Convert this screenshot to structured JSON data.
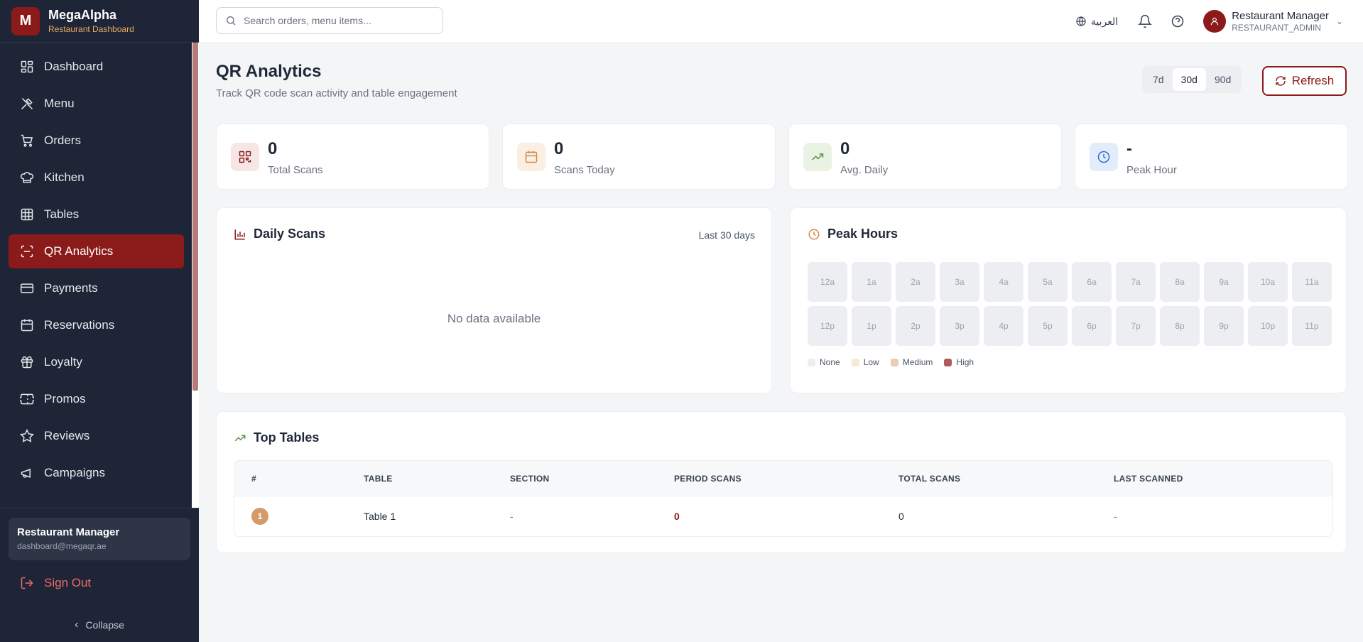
{
  "brand": {
    "logo_letter": "M",
    "name": "MegaAlpha",
    "subtitle": "Restaurant Dashboard"
  },
  "sidebar": {
    "items": [
      {
        "label": "Dashboard",
        "icon": "dashboard-icon"
      },
      {
        "label": "Menu",
        "icon": "utensils-icon"
      },
      {
        "label": "Orders",
        "icon": "cart-icon"
      },
      {
        "label": "Kitchen",
        "icon": "chef-hat-icon"
      },
      {
        "label": "Tables",
        "icon": "grid-icon"
      },
      {
        "label": "QR Analytics",
        "icon": "scan-icon",
        "active": true
      },
      {
        "label": "Payments",
        "icon": "credit-card-icon"
      },
      {
        "label": "Reservations",
        "icon": "calendar-icon"
      },
      {
        "label": "Loyalty",
        "icon": "gift-icon"
      },
      {
        "label": "Promos",
        "icon": "ticket-icon"
      },
      {
        "label": "Reviews",
        "icon": "star-icon"
      },
      {
        "label": "Campaigns",
        "icon": "megaphone-icon"
      }
    ],
    "user": {
      "name": "Restaurant Manager",
      "email": "dashboard@megaqr.ae"
    },
    "signout_label": "Sign Out",
    "collapse_label": "Collapse"
  },
  "header": {
    "search_placeholder": "Search orders, menu items...",
    "language_label": "العربية",
    "user_name": "Restaurant Manager",
    "user_role": "RESTAURANT_ADMIN"
  },
  "page": {
    "title": "QR Analytics",
    "subtitle": "Track QR code scan activity and table engagement",
    "ranges": [
      "7d",
      "30d",
      "90d"
    ],
    "selected_range": "30d",
    "refresh_label": "Refresh"
  },
  "stats": [
    {
      "value": "0",
      "label": "Total Scans",
      "icon": "qr-code-icon",
      "color": "#8b1a1a",
      "bg": "#f7e6e6"
    },
    {
      "value": "0",
      "label": "Scans Today",
      "icon": "calendar-icon",
      "color": "#d48a4a",
      "bg": "#fbeee3"
    },
    {
      "value": "0",
      "label": "Avg. Daily",
      "icon": "trending-up-icon",
      "color": "#5f8f47",
      "bg": "#e9f2e3"
    },
    {
      "value": "-",
      "label": "Peak Hour",
      "icon": "clock-icon",
      "color": "#2f6fd6",
      "bg": "#e3ecfb"
    }
  ],
  "daily_scans": {
    "title": "Daily Scans",
    "range_label": "Last 30 days",
    "empty_label": "No data available"
  },
  "peak_hours": {
    "title": "Peak Hours",
    "hours": [
      "12a",
      "1a",
      "2a",
      "3a",
      "4a",
      "5a",
      "6a",
      "7a",
      "8a",
      "9a",
      "10a",
      "11a",
      "12p",
      "1p",
      "2p",
      "3p",
      "4p",
      "5p",
      "6p",
      "7p",
      "8p",
      "9p",
      "10p",
      "11p"
    ],
    "legend": [
      {
        "label": "None",
        "color": "#eceef1"
      },
      {
        "label": "Low",
        "color": "#f6ead4"
      },
      {
        "label": "Medium",
        "color": "#ebcdb3"
      },
      {
        "label": "High",
        "color": "#b35a5a"
      }
    ]
  },
  "top_tables": {
    "title": "Top Tables",
    "columns": [
      "#",
      "TABLE",
      "SECTION",
      "PERIOD SCANS",
      "TOTAL SCANS",
      "LAST SCANNED"
    ],
    "rows": [
      {
        "rank": "1",
        "table": "Table 1",
        "section": "-",
        "period_scans": "0",
        "total_scans": "0",
        "last_scanned": "-"
      }
    ]
  }
}
